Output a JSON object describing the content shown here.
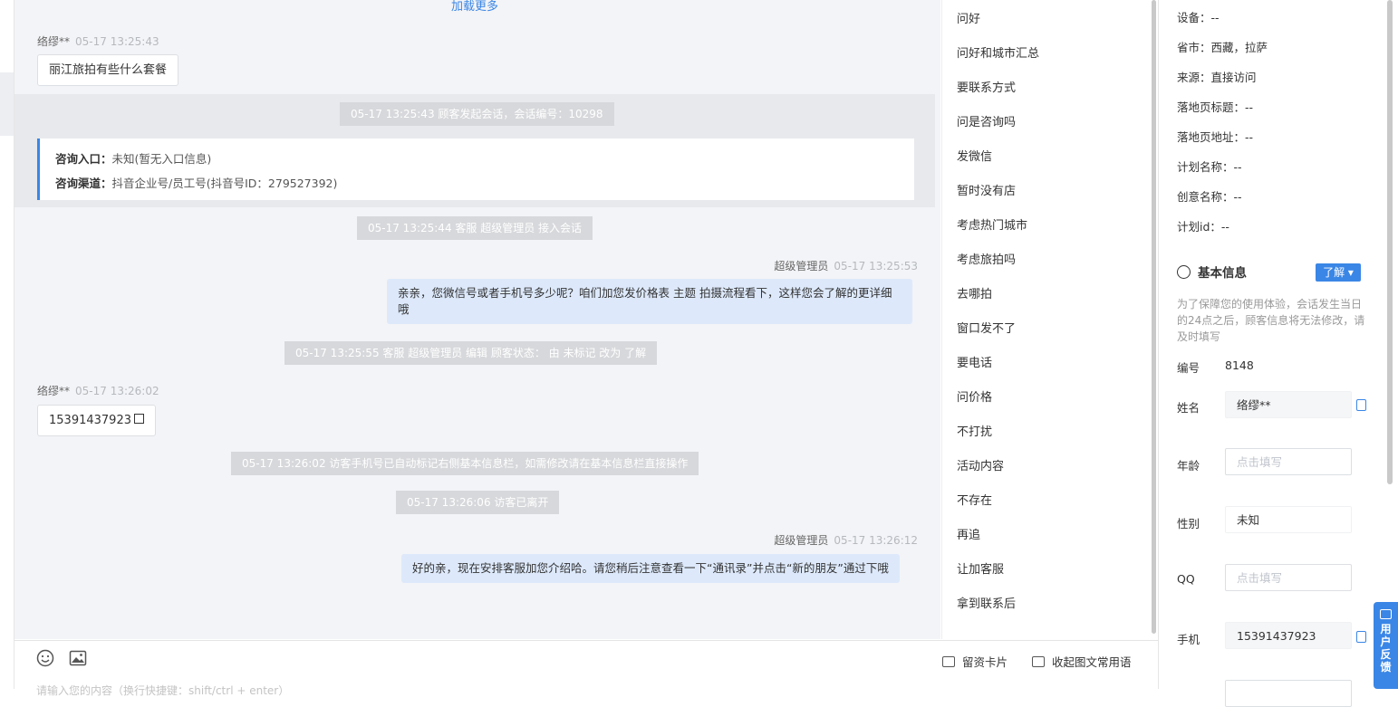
{
  "chat": {
    "load_more": "加载更多",
    "messages": [
      {
        "sender": "络缪**",
        "time": "05-17 13:25:43",
        "text": "丽江旅拍有些什么套餐"
      },
      {
        "system": "05-17 13:25:43 顾客发起会话，会话编号：10298"
      },
      {
        "info_entry_label": "咨询入口：",
        "info_entry_value": "未知(暂无入口信息)",
        "info_channel_label": "咨询渠道：",
        "info_channel_value": "抖音企业号/员工号(抖音号ID：279527392)"
      },
      {
        "system": "05-17 13:25:44 客服 超级管理员 接入会话"
      },
      {
        "sender": "超级管理员",
        "time": "05-17 13:25:53",
        "text": "亲亲，您微信号或者手机号多少呢？咱们加您发价格表 主题 拍摄流程看下，这样您会了解的更详细哦"
      },
      {
        "system": "05-17 13:25:55 客服 超级管理员 编辑 顾客状态： 由 未标记 改为 了解"
      },
      {
        "sender": "络缪**",
        "time": "05-17 13:26:02",
        "text": "15391437923"
      },
      {
        "system": "05-17 13:26:02 访客手机号已自动标记右侧基本信息栏，如需修改请在基本信息栏直接操作"
      },
      {
        "system": "05-17 13:26:06 访客已离开"
      },
      {
        "sender": "超级管理员",
        "time": "05-17 13:26:12",
        "text": "好的亲，现在安排客服加您介绍哈。请您稍后注意查看一下“通讯录”并点击“新的朋友”通过下哦"
      }
    ]
  },
  "phrases": [
    "问好",
    "问好和城市汇总",
    "要联系方式",
    "问是咨询吗",
    "发微信",
    "暂时没有店",
    "考虑热门城市",
    "考虑旅拍吗",
    "去哪拍",
    "窗口发不了",
    "要电话",
    "问价格",
    "不打扰",
    "活动内容",
    "不存在",
    "再追",
    "让加客服",
    "拿到联系后"
  ],
  "input": {
    "placeholder": "请输入您的内容（换行快捷键：shift/ctrl + enter）",
    "emoji_icon": "smile-icon",
    "image_icon": "image-icon",
    "card_label": "留资卡片",
    "collapse_label": "收起图文常用语"
  },
  "customer": {
    "source_rows": [
      "设备：--",
      "省市：西藏，拉萨",
      "来源：直接访问",
      "落地页标题：--",
      "落地页地址：--",
      "计划名称：--",
      "创意名称：--",
      "计划id：--"
    ],
    "section_title": "基本信息",
    "status_button": "了解",
    "notice": "为了保障您的使用体验，会话发生当日的24点之后，顾客信息将无法修改，请及时填写",
    "id_label": "编号",
    "id_value": "8148",
    "name_label": "姓名",
    "name_value": "络缪**",
    "age_label": "年龄",
    "age_placeholder": "点击填写",
    "gender_label": "性别",
    "gender_value": "未知",
    "qq_label": "QQ",
    "qq_placeholder": "点击填写",
    "phone_label": "手机",
    "phone_value": "15391437923",
    "feedback_label": "用户反馈"
  },
  "colors": {
    "accent": "#3a86e6",
    "system_bubble": "#d7d8db",
    "agent_bubble": "#dde9fb"
  }
}
